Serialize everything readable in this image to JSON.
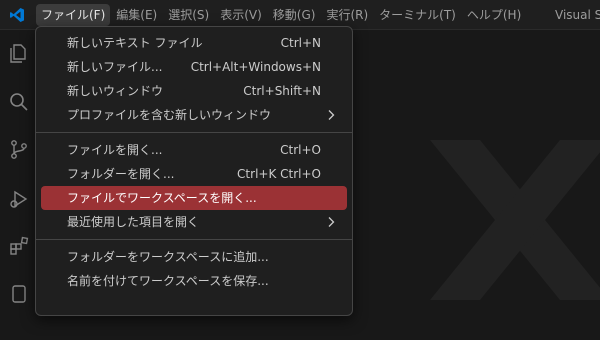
{
  "colors": {
    "background": "#181818",
    "menubar": "#1f1f1f",
    "dropdown_bg": "#1f1f1f",
    "highlight": "#9b3235",
    "vscode_blue": "#0078d4",
    "text": "#cccccc"
  },
  "titlebar": {
    "app_icon": "vscode-logo-icon",
    "menus": [
      {
        "label": "ファイル(F)",
        "active": true
      },
      {
        "label": "編集(E)"
      },
      {
        "label": "選択(S)"
      },
      {
        "label": "表示(V)"
      },
      {
        "label": "移動(G)"
      },
      {
        "label": "実行(R)"
      },
      {
        "label": "ターミナル(T)"
      },
      {
        "label": "ヘルプ(H)"
      }
    ],
    "window_title": "Visual Stu"
  },
  "activitybar": {
    "icons": [
      "explorer-icon",
      "search-icon",
      "source-control-icon",
      "run-debug-icon",
      "extensions-icon",
      "account-icon"
    ]
  },
  "file_menu": {
    "groups": [
      [
        {
          "label": "新しいテキスト ファイル",
          "shortcut": "Ctrl+N"
        },
        {
          "label": "新しいファイル...",
          "shortcut": "Ctrl+Alt+Windows+N"
        },
        {
          "label": "新しいウィンドウ",
          "shortcut": "Ctrl+Shift+N"
        },
        {
          "label": "プロファイルを含む新しいウィンドウ",
          "submenu": true
        }
      ],
      [
        {
          "label": "ファイルを開く...",
          "shortcut": "Ctrl+O"
        },
        {
          "label": "フォルダーを開く...",
          "shortcut": "Ctrl+K Ctrl+O"
        },
        {
          "label": "ファイルでワークスペースを開く...",
          "highlighted": true
        },
        {
          "label": "最近使用した項目を開く",
          "submenu": true
        }
      ],
      [
        {
          "label": "フォルダーをワークスペースに追加..."
        },
        {
          "label": "名前を付けてワークスペースを保存..."
        }
      ]
    ]
  }
}
